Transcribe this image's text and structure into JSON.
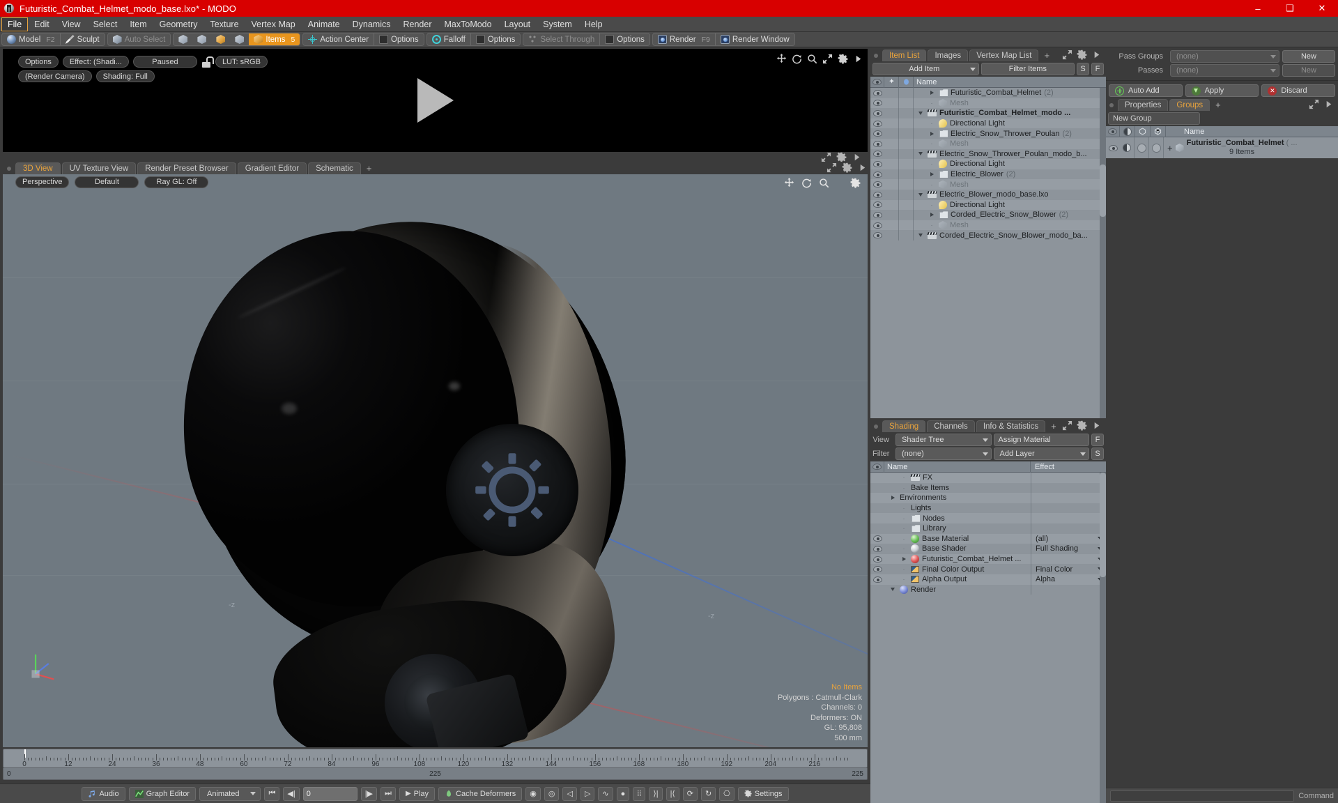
{
  "window": {
    "title": "Futuristic_Combat_Helmet_modo_base.lxo* - MODO",
    "minimize": "–",
    "maximize": "❑",
    "close": "✕"
  },
  "menubar": [
    {
      "label": "File",
      "active": true
    },
    {
      "label": "Edit"
    },
    {
      "label": "View"
    },
    {
      "label": "Select"
    },
    {
      "label": "Item"
    },
    {
      "label": "Geometry"
    },
    {
      "label": "Texture"
    },
    {
      "label": "Vertex Map"
    },
    {
      "label": "Animate"
    },
    {
      "label": "Dynamics"
    },
    {
      "label": "Render"
    },
    {
      "label": "MaxToModo"
    },
    {
      "label": "Layout"
    },
    {
      "label": "System"
    },
    {
      "label": "Help"
    }
  ],
  "toolbar": {
    "model": "Model",
    "model_key": "F2",
    "sculpt": "Sculpt",
    "auto_select": "Auto Select",
    "items": "Items",
    "items_key": "5",
    "action_center": "Action Center",
    "options_1": "Options",
    "falloff": "Falloff",
    "options_2": "Options",
    "select_through": "Select Through",
    "options_3": "Options",
    "render": "Render",
    "render_key": "F9",
    "render_window": "Render Window"
  },
  "preview": {
    "options": "Options",
    "effect": "Effect: (Shadi...",
    "paused": "Paused",
    "lut": "LUT: sRGB",
    "render_camera": "(Render Camera)",
    "shading": "Shading: Full"
  },
  "viewport_tabs": [
    {
      "label": "3D View",
      "selected": true
    },
    {
      "label": "UV Texture View"
    },
    {
      "label": "Render Preset Browser"
    },
    {
      "label": "Gradient Editor"
    },
    {
      "label": "Schematic"
    }
  ],
  "viewport_tab_plus": "+",
  "viewport": {
    "perspective": "Perspective",
    "default": "Default",
    "raygl": "Ray GL: Off",
    "z_label_left": "-z",
    "z_label_right": "-z",
    "info": {
      "no_items": "No Items",
      "polygons": "Polygons : Catmull-Clark",
      "channels": "Channels: 0",
      "deformers": "Deformers: ON",
      "gl": "GL: 95,808",
      "scale": "500 mm"
    }
  },
  "timeline": {
    "ticks": [
      "0",
      "12",
      "24",
      "36",
      "48",
      "60",
      "72",
      "84",
      "96",
      "108",
      "120",
      "132",
      "144",
      "156",
      "168",
      "180",
      "192",
      "204",
      "216"
    ],
    "range_start": "0",
    "range_mid": "225",
    "range_end": "225"
  },
  "bottombar": {
    "audio": "Audio",
    "graph_editor": "Graph Editor",
    "animated": "Animated",
    "frame": "0",
    "play": "Play",
    "cache_deformers": "Cache Deformers",
    "settings": "Settings"
  },
  "item_list": {
    "tabs": [
      {
        "label": "Item List",
        "selected": true
      },
      {
        "label": "Images"
      },
      {
        "label": "Vertex Map List"
      }
    ],
    "tab_plus": "+",
    "add_item": "Add Item",
    "filter_items": "Filter Items",
    "btn_s": "S",
    "btn_f": "F",
    "col_name": "Name",
    "rows": [
      {
        "indent": 0,
        "toggle": "down",
        "icon": "film",
        "label": "Corded_Electric_Snow_Blower_modo_ba...",
        "count": "",
        "dim": false,
        "bold": false
      },
      {
        "indent": 1,
        "toggle": "none",
        "icon": "mesh",
        "label": "Mesh",
        "count": "",
        "dim": true,
        "bold": false
      },
      {
        "indent": 1,
        "toggle": "right",
        "icon": "fold",
        "label": "Corded_Electric_Snow_Blower",
        "count": "(2)",
        "dim": false,
        "bold": false
      },
      {
        "indent": 1,
        "toggle": "none",
        "icon": "light",
        "label": "Directional Light",
        "count": "",
        "dim": false,
        "bold": false
      },
      {
        "indent": 0,
        "toggle": "down",
        "icon": "film",
        "label": "Electric_Blower_modo_base.lxo",
        "count": "",
        "dim": false,
        "bold": false
      },
      {
        "indent": 1,
        "toggle": "none",
        "icon": "mesh",
        "label": "Mesh",
        "count": "",
        "dim": true,
        "bold": false
      },
      {
        "indent": 1,
        "toggle": "right",
        "icon": "fold",
        "label": "Electric_Blower",
        "count": "(2)",
        "dim": false,
        "bold": false
      },
      {
        "indent": 1,
        "toggle": "none",
        "icon": "light",
        "label": "Directional Light",
        "count": "",
        "dim": false,
        "bold": false
      },
      {
        "indent": 0,
        "toggle": "down",
        "icon": "film",
        "label": "Electric_Snow_Thrower_Poulan_modo_b...",
        "count": "",
        "dim": false,
        "bold": false
      },
      {
        "indent": 1,
        "toggle": "none",
        "icon": "mesh",
        "label": "Mesh",
        "count": "",
        "dim": true,
        "bold": false
      },
      {
        "indent": 1,
        "toggle": "right",
        "icon": "fold",
        "label": "Electric_Snow_Thrower_Poulan",
        "count": "(2)",
        "dim": false,
        "bold": false
      },
      {
        "indent": 1,
        "toggle": "none",
        "icon": "light",
        "label": "Directional Light",
        "count": "",
        "dim": false,
        "bold": false
      },
      {
        "indent": 0,
        "toggle": "down",
        "icon": "film",
        "label": "Futuristic_Combat_Helmet_modo ...",
        "count": "",
        "dim": false,
        "bold": true
      },
      {
        "indent": 1,
        "toggle": "none",
        "icon": "mesh",
        "label": "Mesh",
        "count": "",
        "dim": true,
        "bold": false
      },
      {
        "indent": 1,
        "toggle": "right",
        "icon": "fold",
        "label": "Futuristic_Combat_Helmet",
        "count": "(2)",
        "dim": false,
        "bold": false
      }
    ]
  },
  "shading": {
    "tabs": [
      {
        "label": "Shading",
        "selected": true
      },
      {
        "label": "Channels"
      },
      {
        "label": "Info & Statistics"
      }
    ],
    "tab_plus": "+",
    "view_label": "View",
    "view_value": "Shader Tree",
    "assign_material": "Assign Material",
    "btn_f": "F",
    "filter_label": "Filter",
    "filter_value": "(none)",
    "add_layer": "Add Layer",
    "btn_s": "S",
    "col_name": "Name",
    "col_effect": "Effect",
    "rows": [
      {
        "indent": 0,
        "toggle": "down",
        "icon": "sphere-b",
        "label": "Render",
        "effect": "",
        "eye": false,
        "dropdown": false
      },
      {
        "indent": 1,
        "toggle": "none",
        "icon": "img",
        "label": "Alpha Output",
        "effect": "Alpha",
        "eye": true,
        "dropdown": true
      },
      {
        "indent": 1,
        "toggle": "none",
        "icon": "img",
        "label": "Final Color Output",
        "effect": "Final Color",
        "eye": true,
        "dropdown": true
      },
      {
        "indent": 1,
        "toggle": "right",
        "icon": "sphere-r",
        "label": "Futuristic_Combat_Helmet ...",
        "effect": "",
        "eye": true,
        "dropdown": true
      },
      {
        "indent": 1,
        "toggle": "none",
        "icon": "sphere-w",
        "label": "Base Shader",
        "effect": "Full Shading",
        "eye": true,
        "dropdown": true
      },
      {
        "indent": 1,
        "toggle": "none",
        "icon": "sphere-g",
        "label": "Base Material",
        "effect": "(all)",
        "eye": true,
        "dropdown": true
      },
      {
        "indent": 1,
        "toggle": "none",
        "icon": "fold",
        "label": "Library",
        "effect": "",
        "eye": false,
        "dropdown": false
      },
      {
        "indent": 1,
        "toggle": "none",
        "icon": "fold",
        "label": "Nodes",
        "effect": "",
        "eye": false,
        "dropdown": false
      },
      {
        "indent": 1,
        "toggle": "none",
        "icon": "none",
        "label": "Lights",
        "effect": "",
        "eye": false,
        "dropdown": false
      },
      {
        "indent": 0,
        "toggle": "right",
        "icon": "none",
        "label": "Environments",
        "effect": "",
        "eye": false,
        "dropdown": false
      },
      {
        "indent": 1,
        "toggle": "none",
        "icon": "none",
        "label": "Bake Items",
        "effect": "",
        "eye": false,
        "dropdown": false
      },
      {
        "indent": 1,
        "toggle": "none",
        "icon": "film",
        "label": "FX",
        "effect": "",
        "eye": false,
        "dropdown": false
      }
    ]
  },
  "passes": {
    "pass_groups_label": "Pass Groups",
    "pass_groups_value": "(none)",
    "pass_groups_new": "New",
    "passes_label": "Passes",
    "passes_value": "(none)",
    "passes_new": "New",
    "auto_add": "Auto Add",
    "apply": "Apply",
    "discard": "Discard"
  },
  "groups": {
    "tabs": [
      {
        "label": "Properties",
        "selected": false
      },
      {
        "label": "Groups",
        "selected": true
      }
    ],
    "tab_plus": "+",
    "new_group": "New Group",
    "col_name": "Name",
    "row": {
      "label": "Futuristic_Combat_Helmet",
      "suffix": "( ...",
      "sub": "9 Items",
      "plus": "+"
    }
  },
  "command": {
    "placeholder": "Command"
  }
}
